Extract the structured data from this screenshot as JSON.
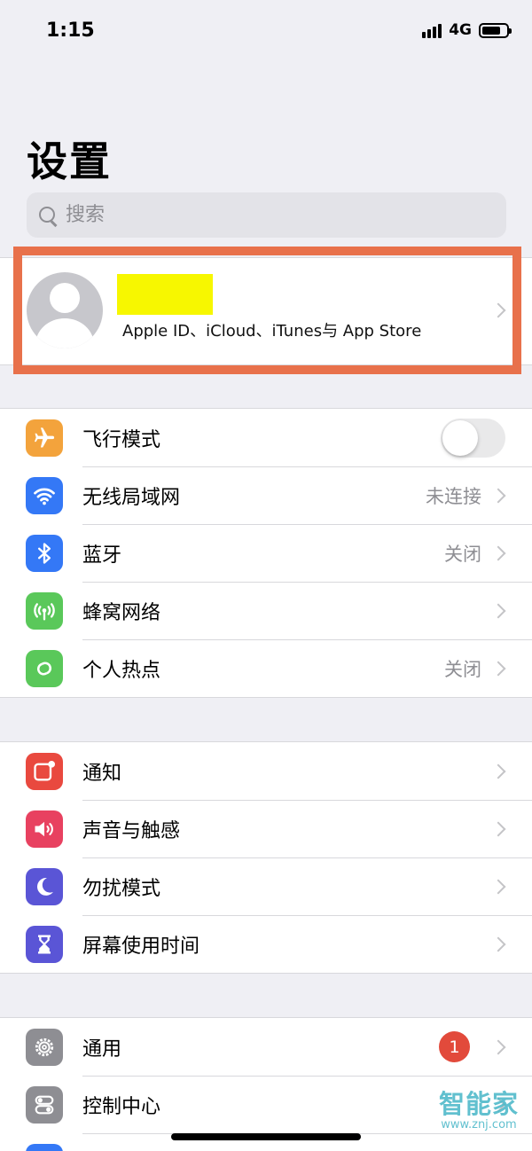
{
  "status_bar": {
    "time": "1:15",
    "network": "4G",
    "battery_level": 0.78
  },
  "page_title": "设置",
  "search": {
    "placeholder": "搜索"
  },
  "profile": {
    "subtitle": "Apple ID、iCloud、iTunes与 App Store"
  },
  "groups": [
    {
      "items": [
        {
          "label": "飞行模式",
          "icon": "airplane-icon",
          "color": "#f3a33c",
          "toggle": false
        },
        {
          "label": "无线局域网",
          "icon": "wifi-icon",
          "color": "#3478f6",
          "value": "未连接"
        },
        {
          "label": "蓝牙",
          "icon": "bluetooth-icon",
          "color": "#3478f6",
          "value": "关闭"
        },
        {
          "label": "蜂窝网络",
          "icon": "cellular-antenna-icon",
          "color": "#5ac85a"
        },
        {
          "label": "个人热点",
          "icon": "hotspot-icon",
          "color": "#5ac85a",
          "value": "关闭"
        }
      ]
    },
    {
      "items": [
        {
          "label": "通知",
          "icon": "notifications-icon",
          "color": "#e9493f"
        },
        {
          "label": "声音与触感",
          "icon": "speaker-icon",
          "color": "#e84160"
        },
        {
          "label": "勿扰模式",
          "icon": "moon-icon",
          "color": "#5a55d6"
        },
        {
          "label": "屏幕使用时间",
          "icon": "hourglass-icon",
          "color": "#5a55d6"
        }
      ]
    },
    {
      "items": [
        {
          "label": "通用",
          "icon": "gear-icon",
          "color": "#8e8e93",
          "badge": "1"
        },
        {
          "label": "控制中心",
          "icon": "toggles-icon",
          "color": "#8e8e93"
        }
      ]
    }
  ],
  "watermark": {
    "main": "智能家",
    "url": "www.znj.com"
  }
}
